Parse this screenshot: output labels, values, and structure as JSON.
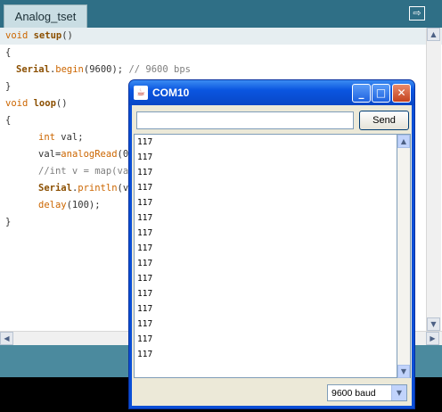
{
  "ide": {
    "tab_label": "Analog_tset",
    "tab_arrow": "⇨",
    "code": {
      "l1": {
        "kw": "void ",
        "fn": "setup",
        "rest": "()"
      },
      "l2": "{",
      "l3": {
        "fn": "Serial",
        "m1": ".",
        "kw": "begin",
        "m2": "(9600); ",
        "cm": "// 9600 bps"
      },
      "l4": "}",
      "l5": {
        "kw": "void ",
        "fn": "loop",
        "rest": "()"
      },
      "l6": "{",
      "l7": {
        "kw": "int",
        "rest": " val;"
      },
      "l8": {
        "pre": "val=",
        "kw": "analogRead",
        "rest": "(0)"
      },
      "l9": {
        "cm": "//int v = map(val"
      },
      "l10": {
        "fn": "Serial",
        "m1": ".",
        "kw": "println",
        "rest": "(v"
      },
      "l11": {
        "kw": "delay",
        "rest": "(100);"
      },
      "l12": "}"
    }
  },
  "serial_monitor": {
    "title": "COM10",
    "send_input_value": "",
    "send_label": "Send",
    "output_lines": [
      "117",
      "117",
      "117",
      "117",
      "117",
      "117",
      "117",
      "117",
      "117",
      "117",
      "117",
      "117",
      "117",
      "117",
      "117"
    ],
    "baud": "9600 baud"
  },
  "colors": {
    "keyword": "#cc6600",
    "function": "#8b4f00",
    "comment": "#7e7e7e",
    "titlebar": "#0a55e0",
    "ide_frame": "#2f6f86"
  },
  "icons": {
    "scroll_up": "▲",
    "scroll_down": "▼",
    "scroll_left": "◀",
    "scroll_right": "▶",
    "minimize": "_",
    "maximize": "□",
    "close": "✕",
    "dropdown": "▼",
    "java": "☕"
  }
}
